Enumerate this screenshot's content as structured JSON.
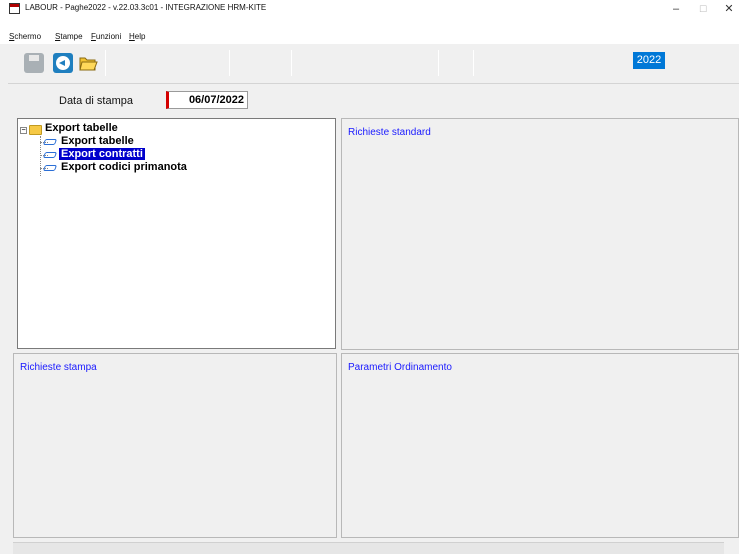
{
  "window": {
    "title": "LABOUR - Paghe2022 - v.22.03.3c01 - INTEGRAZIONE HRM-KITE",
    "minimize": "–",
    "maximize": "☐",
    "close": "✕"
  },
  "menu": {
    "items": [
      {
        "ul": "S",
        "rest": "chermo"
      },
      {
        "ul": "S",
        "rest": "tampe"
      },
      {
        "ul": "F",
        "rest": "unzioni"
      },
      {
        "ul": "H",
        "rest": "elp"
      }
    ]
  },
  "toolbar": {
    "year": "2022",
    "icons": [
      "save-icon",
      "back-icon",
      "open-folder-icon"
    ]
  },
  "form": {
    "date_label": "Data di stampa",
    "date_value": "06/07/2022"
  },
  "tree": {
    "root": "Export tabelle",
    "children": [
      {
        "label": "Export tabelle",
        "selected": false
      },
      {
        "label": "Export contratti",
        "selected": true
      },
      {
        "label": "Export codici primanota",
        "selected": false
      }
    ]
  },
  "panels": {
    "standard_title": "Richieste standard",
    "stampa_title": "Richieste stampa",
    "ordinamento_title": "Parametri Ordinamento"
  },
  "colors": {
    "accent": "#0078d7",
    "selection": "#0000cc",
    "panel_title": "#1a1aff",
    "required_marker": "#d40000"
  }
}
